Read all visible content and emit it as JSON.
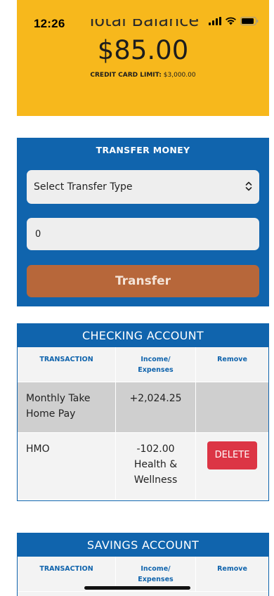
{
  "status_bar": {
    "time": "12:26"
  },
  "balance": {
    "title": "Total Balance",
    "amount": "$85.00",
    "credit_limit_label": "CREDIT CARD LIMIT:",
    "credit_limit_value": "$3,000.00"
  },
  "transfer": {
    "title": "TRANSFER MONEY",
    "select_value": "Select Transfer Type",
    "amount_value": "0",
    "button_label": "Transfer"
  },
  "checking": {
    "title": "CHECKING ACCOUNT",
    "headers": [
      "TRANSACTION",
      "Income/\nExpenses",
      "Remove"
    ],
    "rows": [
      {
        "transaction": "Monthly Take Home Pay",
        "amount": "+2,024.25",
        "category": "",
        "action": ""
      },
      {
        "transaction": "HMO",
        "amount": "-102.00",
        "category": "Health & Wellness",
        "action": "DELETE"
      }
    ]
  },
  "savings": {
    "title": "SAVINGS ACCOUNT",
    "headers": [
      "TRANSACTION",
      "Income/\nExpenses",
      "Remove"
    ]
  },
  "colors": {
    "balance_bg": "#f7b81c",
    "primary_blue": "#1064ad",
    "transfer_button": "#b7673a",
    "delete_red": "#dc3545"
  }
}
